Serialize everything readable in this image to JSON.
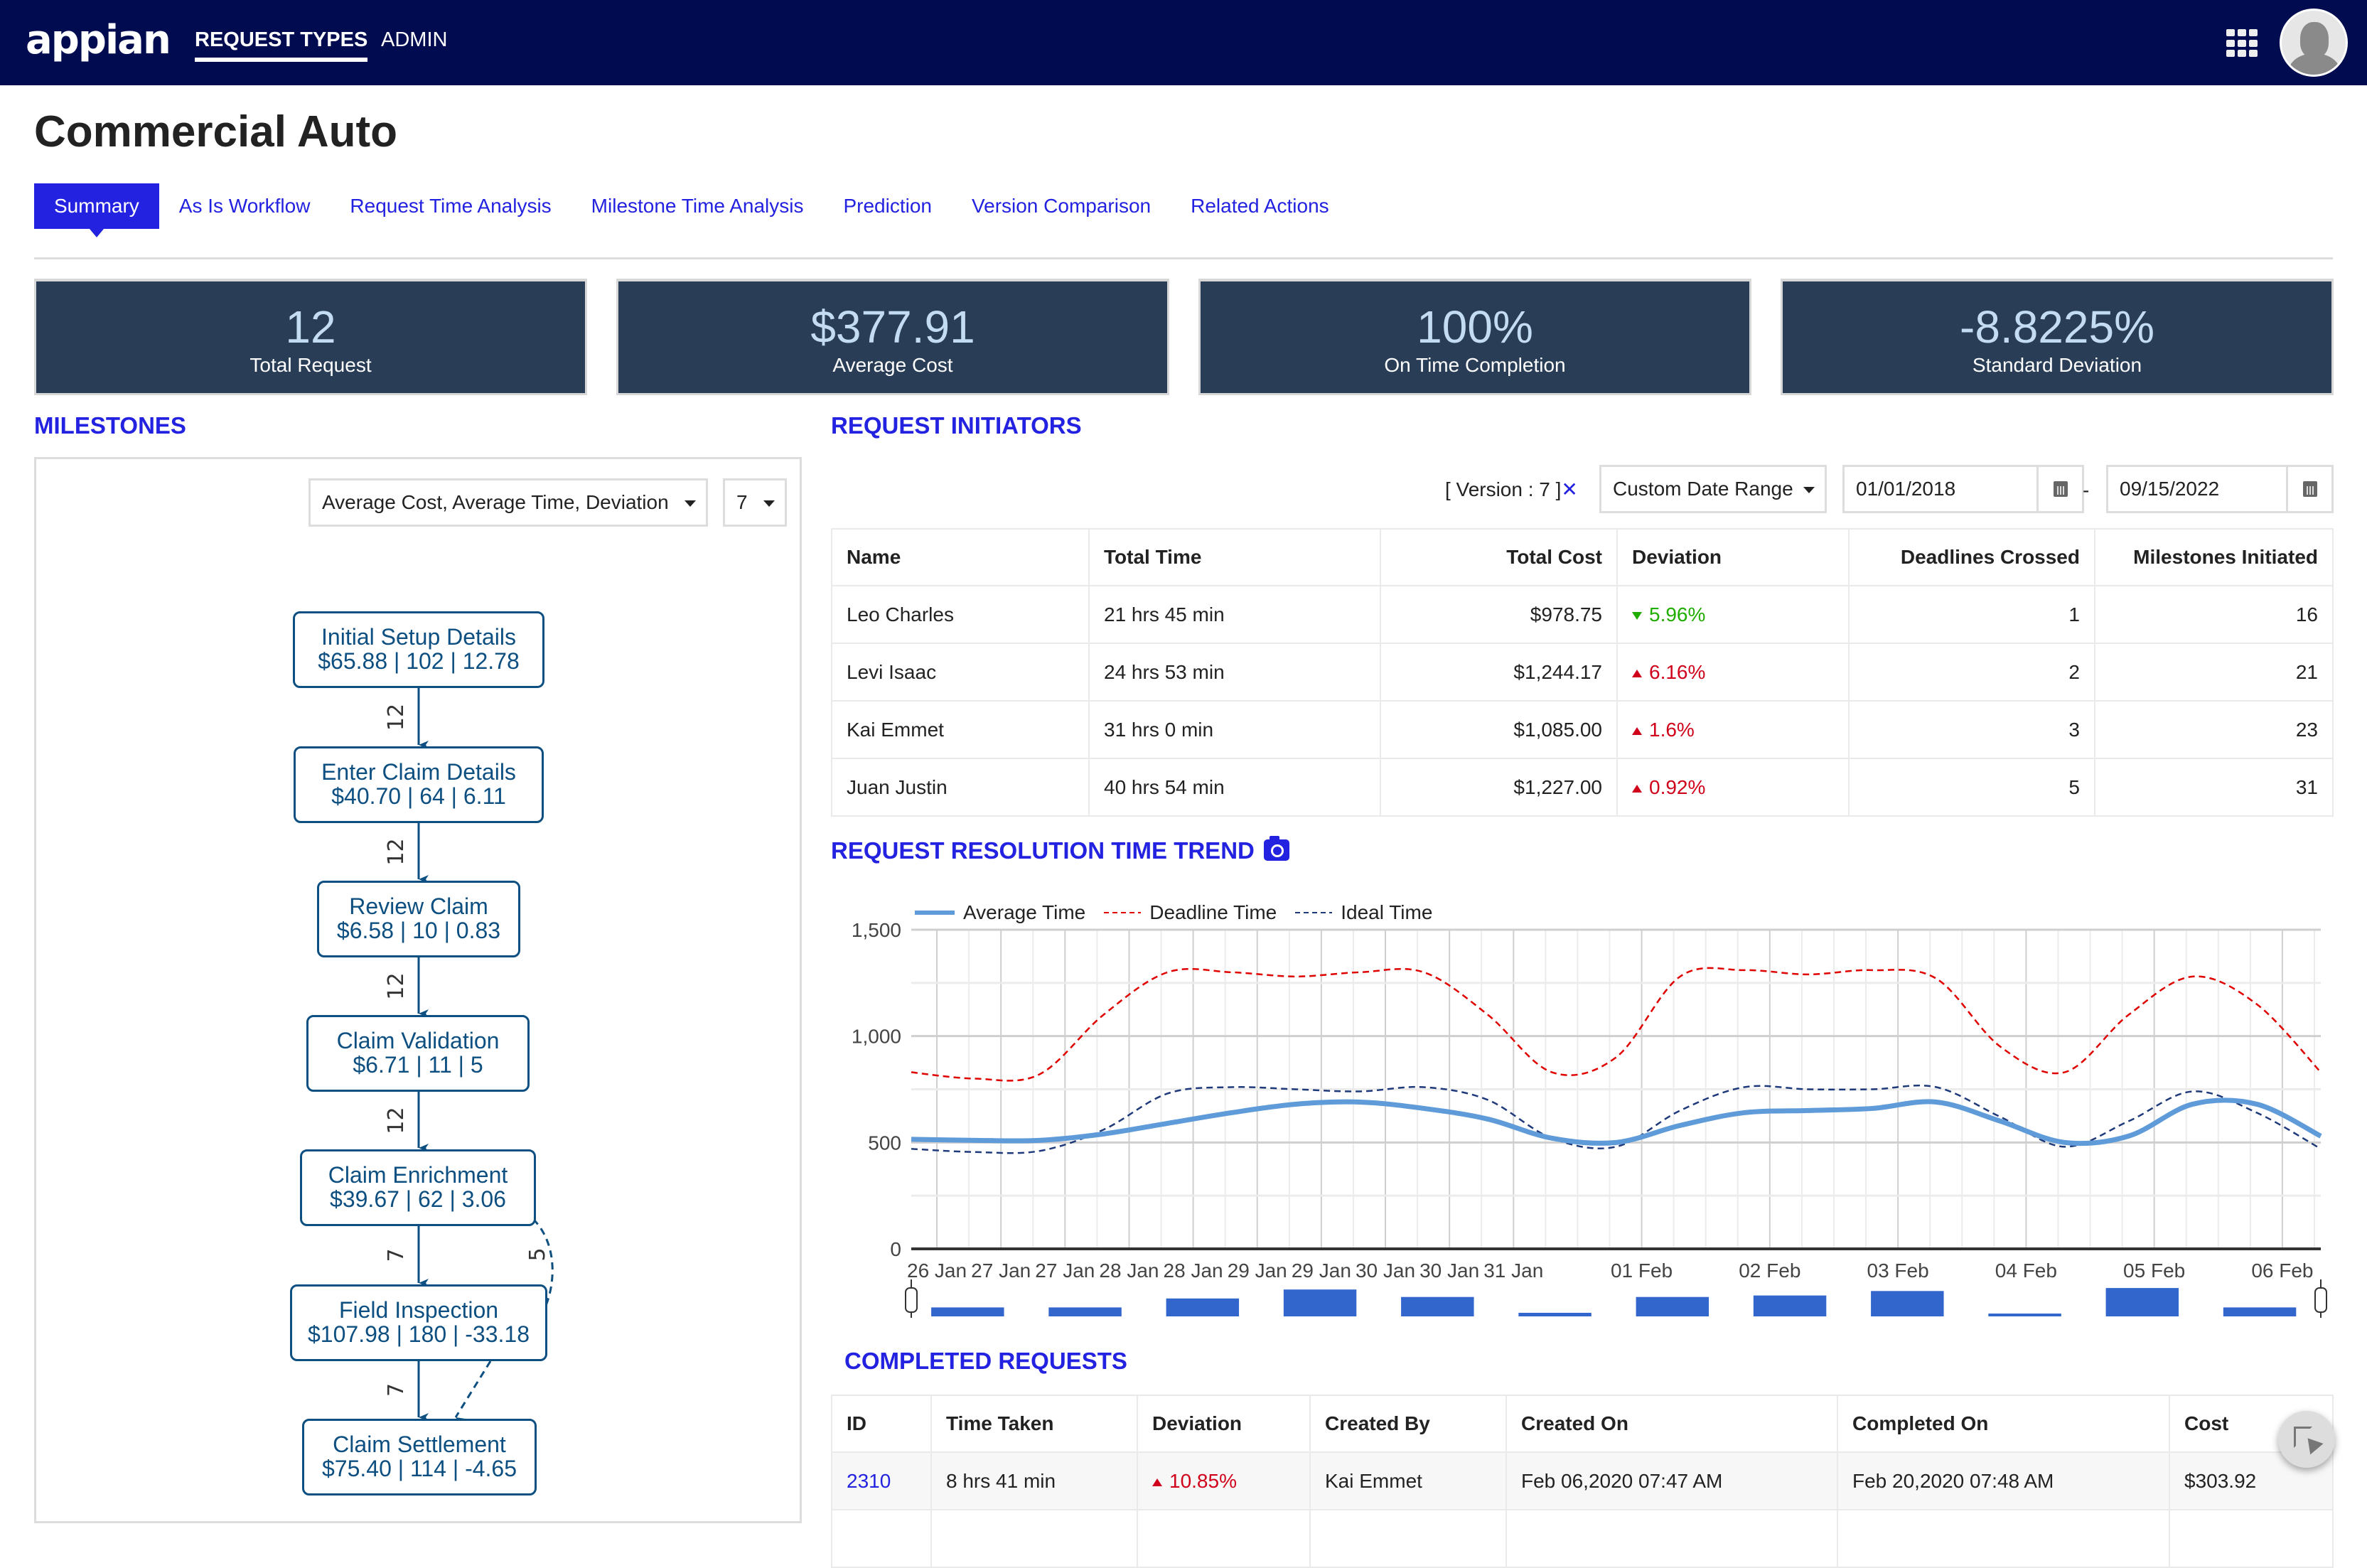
{
  "app": {
    "logo": "appian",
    "nav": [
      {
        "label": "REQUEST TYPES",
        "active": true
      },
      {
        "label": "ADMIN",
        "active": false
      }
    ],
    "icons": {
      "apps": "grid-apps-icon",
      "user": "user-avatar-icon"
    }
  },
  "page": {
    "title": "Commercial Auto",
    "tabs": [
      {
        "label": "Summary",
        "active": true
      },
      {
        "label": "As Is Workflow",
        "active": false
      },
      {
        "label": "Request Time Analysis",
        "active": false
      },
      {
        "label": "Milestone Time Analysis",
        "active": false
      },
      {
        "label": "Prediction",
        "active": false
      },
      {
        "label": "Version Comparison",
        "active": false
      },
      {
        "label": "Related Actions",
        "active": false
      }
    ]
  },
  "kpis": [
    {
      "value": "12",
      "label": "Total Request"
    },
    {
      "value": "$377.91",
      "label": "Average Cost"
    },
    {
      "value": "100%",
      "label": "On Time Completion"
    },
    {
      "value": "-8.8225%",
      "label": "Standard Deviation"
    }
  ],
  "milestones": {
    "title": "MILESTONES",
    "metric_select": "Average Cost, Average Time, Deviation",
    "version_select": "7",
    "nodes": [
      {
        "name": "Initial Setup Details",
        "stats": "$65.88 | 102 | 12.78"
      },
      {
        "name": "Enter Claim Details",
        "stats": "$40.70 | 64 | 6.11"
      },
      {
        "name": "Review Claim",
        "stats": "$6.58 | 10 | 0.83"
      },
      {
        "name": "Claim Validation",
        "stats": "$6.71 | 11 | 5"
      },
      {
        "name": "Claim Enrichment",
        "stats": "$39.67 | 62 | 3.06"
      },
      {
        "name": "Field Inspection",
        "stats": "$107.98 | 180 | -33.18"
      },
      {
        "name": "Claim Settlement",
        "stats": "$75.40 | 114 | -4.65"
      }
    ],
    "edges": [
      {
        "from": 0,
        "to": 1,
        "count": "12",
        "style": "solid"
      },
      {
        "from": 1,
        "to": 2,
        "count": "12",
        "style": "solid"
      },
      {
        "from": 2,
        "to": 3,
        "count": "12",
        "style": "solid"
      },
      {
        "from": 3,
        "to": 4,
        "count": "12",
        "style": "solid"
      },
      {
        "from": 4,
        "to": 5,
        "count": "7",
        "style": "solid"
      },
      {
        "from": 4,
        "to": 6,
        "count": "5",
        "style": "dashed"
      },
      {
        "from": 5,
        "to": 6,
        "count": "7",
        "style": "solid"
      }
    ]
  },
  "initiators": {
    "title": "REQUEST INITIATORS",
    "version_tag": "[ Version : 7 ]",
    "version_clear": "✕",
    "date_range_select": "Custom Date Range",
    "start_date": "01/01/2018",
    "end_date": "09/15/2022",
    "date_separator": "-",
    "columns": [
      "Name",
      "Total Time",
      "Total Cost",
      "Deviation",
      "Deadlines Crossed",
      "Milestones Initiated"
    ],
    "rows": [
      {
        "name": "Leo Charles",
        "total_time": "21 hrs 45 min",
        "total_cost": "$978.75",
        "deviation": "5.96%",
        "direction": "down",
        "deadlines": "1",
        "milestones": "16"
      },
      {
        "name": "Levi Isaac",
        "total_time": "24 hrs 53 min",
        "total_cost": "$1,244.17",
        "deviation": "6.16%",
        "direction": "up",
        "deadlines": "2",
        "milestones": "21"
      },
      {
        "name": "Kai Emmet",
        "total_time": "31 hrs 0 min",
        "total_cost": "$1,085.00",
        "deviation": "1.6%",
        "direction": "up",
        "deadlines": "3",
        "milestones": "23"
      },
      {
        "name": "Juan Justin",
        "total_time": "40 hrs 54 min",
        "total_cost": "$1,227.00",
        "deviation": "0.92%",
        "direction": "up",
        "deadlines": "5",
        "milestones": "31"
      }
    ]
  },
  "trend": {
    "title": "REQUEST RESOLUTION TIME TREND",
    "camera_icon": "camera-icon"
  },
  "chart_data": {
    "type": "line",
    "title": "REQUEST RESOLUTION TIME TREND",
    "xlabel": "",
    "ylabel": "",
    "ylim": [
      0,
      1500
    ],
    "yticks": [
      "0",
      "500",
      "1,000",
      "1,500"
    ],
    "ytick_values": [
      0,
      500,
      1000,
      1500
    ],
    "grid": true,
    "legend": "top-left",
    "x_tick_labels": [
      "26 Jan",
      "27 Jan",
      "27 Jan",
      "28 Jan",
      "28 Jan",
      "29 Jan",
      "29 Jan",
      "30 Jan",
      "30 Jan",
      "31 Jan",
      "01 Feb",
      "02 Feb",
      "03 Feb",
      "04 Feb",
      "05 Feb",
      "06 Feb"
    ],
    "x_tick_positions_days": [
      0.5,
      1.0,
      1.5,
      2.0,
      2.5,
      3.0,
      3.5,
      4.0,
      4.5,
      5.0,
      6.0,
      7.0,
      8.0,
      9.0,
      10.0,
      11.0
    ],
    "x_range_days": [
      0.3,
      11.3
    ],
    "x_days": [
      0.3,
      0.8,
      1.3,
      1.8,
      2.3,
      2.8,
      3.3,
      3.8,
      4.3,
      4.8,
      5.3,
      5.8,
      6.3,
      6.8,
      7.3,
      7.8,
      8.3,
      8.8,
      9.3,
      9.8,
      10.3,
      10.8,
      11.3
    ],
    "series": [
      {
        "name": "Average Time",
        "color": "#5e9bd8",
        "style": "solid",
        "values": [
          515,
          510,
          510,
          540,
          590,
          640,
          680,
          690,
          660,
          610,
          520,
          500,
          580,
          640,
          650,
          660,
          690,
          600,
          500,
          530,
          680,
          680,
          530
        ]
      },
      {
        "name": "Deadline Time",
        "color": "#e00000",
        "style": "dashed",
        "values": [
          830,
          800,
          820,
          1100,
          1300,
          1300,
          1280,
          1300,
          1300,
          1100,
          830,
          900,
          1280,
          1310,
          1290,
          1310,
          1270,
          950,
          830,
          1100,
          1280,
          1150,
          830
        ]
      },
      {
        "name": "Ideal Time",
        "color": "#1f3a7a",
        "style": "dashed",
        "values": [
          470,
          455,
          460,
          560,
          730,
          760,
          750,
          740,
          760,
          700,
          520,
          480,
          650,
          760,
          750,
          750,
          760,
          620,
          480,
          600,
          740,
          640,
          470
        ]
      }
    ],
    "navigator": {
      "values": [
        0.3,
        0.3,
        0.6,
        0.9,
        0.65,
        0.12,
        0.65,
        0.7,
        0.85,
        0.08,
        0.95,
        0.3
      ],
      "color": "#3366cc"
    }
  },
  "completed": {
    "title": "COMPLETED REQUESTS",
    "columns": [
      "ID",
      "Time Taken",
      "Deviation",
      "Created By",
      "Created On",
      "Completed On",
      "Cost"
    ],
    "rows": [
      {
        "id": "2310",
        "time_taken": "8 hrs 41 min",
        "deviation": "10.85%",
        "direction": "up",
        "created_by": "Kai Emmet",
        "created_on": "Feb 06,2020 07:47 AM",
        "completed_on": "Feb 20,2020 07:48 AM",
        "cost": "$303.92"
      }
    ]
  },
  "fab": {
    "icon": "select-cursor-icon"
  }
}
